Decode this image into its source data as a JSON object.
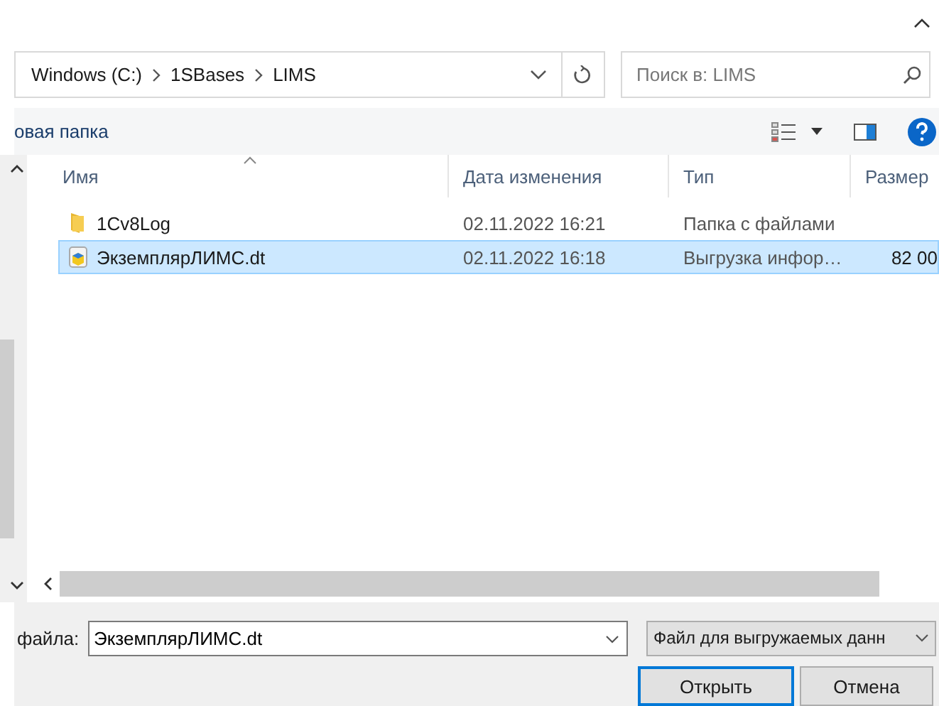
{
  "address": {
    "path": [
      "Windows (C:)",
      "1SBases",
      "LIMS"
    ]
  },
  "search": {
    "placeholder": "Поиск в: LIMS"
  },
  "toolbar": {
    "new_folder": "овая папка"
  },
  "columns": [
    "Имя",
    "Дата изменения",
    "Тип",
    "Размер"
  ],
  "rows": [
    {
      "kind": "folder",
      "name": "1Cv8Log",
      "date": "02.11.2022 16:21",
      "type": "Папка с файлами",
      "selected": false
    },
    {
      "kind": "file",
      "name": "ЭкземплярЛИМС.dt",
      "date": "02.11.2022 16:18",
      "type": "Выгрузка инфор…",
      "size": "82 00",
      "selected": true
    }
  ],
  "file_name": {
    "label": "файла:",
    "value": "ЭкземплярЛИМС.dt"
  },
  "file_type": {
    "value": "Файл для выгружаемых данн"
  },
  "buttons": [
    {
      "label": "Открыть",
      "default": true
    },
    {
      "label": "Отмена",
      "default": false
    }
  ]
}
